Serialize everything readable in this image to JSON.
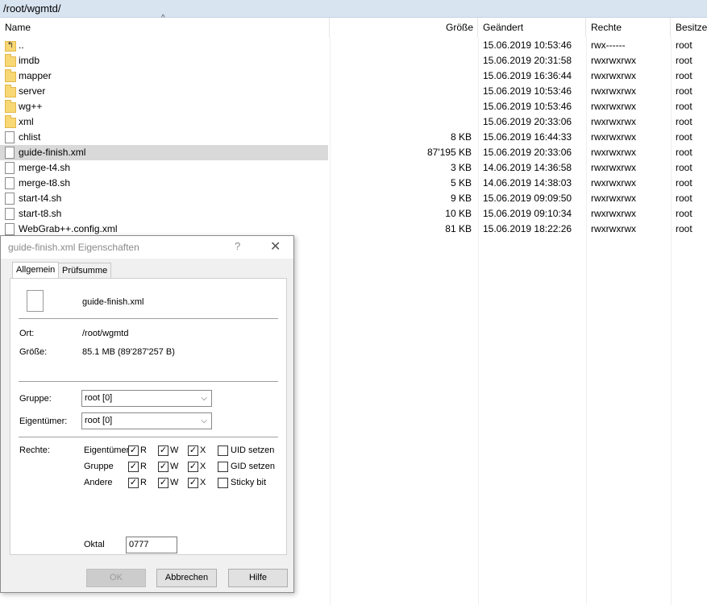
{
  "path": "/root/wgmtd/",
  "columns": {
    "name": "Name",
    "size": "Größe",
    "modified": "Geändert",
    "perms": "Rechte",
    "owner": "Besitzer"
  },
  "files": [
    {
      "name": "..",
      "size": "",
      "modified": "15.06.2019 10:53:46",
      "perms": "rwx------",
      "owner": "root",
      "type": "up"
    },
    {
      "name": "imdb",
      "size": "",
      "modified": "15.06.2019 20:31:58",
      "perms": "rwxrwxrwx",
      "owner": "root",
      "type": "folder"
    },
    {
      "name": "mapper",
      "size": "",
      "modified": "15.06.2019 16:36:44",
      "perms": "rwxrwxrwx",
      "owner": "root",
      "type": "folder"
    },
    {
      "name": "server",
      "size": "",
      "modified": "15.06.2019 10:53:46",
      "perms": "rwxrwxrwx",
      "owner": "root",
      "type": "folder"
    },
    {
      "name": "wg++",
      "size": "",
      "modified": "15.06.2019 10:53:46",
      "perms": "rwxrwxrwx",
      "owner": "root",
      "type": "folder"
    },
    {
      "name": "xml",
      "size": "",
      "modified": "15.06.2019 20:33:06",
      "perms": "rwxrwxrwx",
      "owner": "root",
      "type": "folder"
    },
    {
      "name": "chlist",
      "size": "8 KB",
      "modified": "15.06.2019 16:44:33",
      "perms": "rwxrwxrwx",
      "owner": "root",
      "type": "file"
    },
    {
      "name": "guide-finish.xml",
      "size": "87'195 KB",
      "modified": "15.06.2019 20:33:06",
      "perms": "rwxrwxrwx",
      "owner": "root",
      "type": "file",
      "selected": true
    },
    {
      "name": "merge-t4.sh",
      "size": "3 KB",
      "modified": "14.06.2019 14:36:58",
      "perms": "rwxrwxrwx",
      "owner": "root",
      "type": "file"
    },
    {
      "name": "merge-t8.sh",
      "size": "5 KB",
      "modified": "14.06.2019 14:38:03",
      "perms": "rwxrwxrwx",
      "owner": "root",
      "type": "file"
    },
    {
      "name": "start-t4.sh",
      "size": "9 KB",
      "modified": "15.06.2019 09:09:50",
      "perms": "rwxrwxrwx",
      "owner": "root",
      "type": "file"
    },
    {
      "name": "start-t8.sh",
      "size": "10 KB",
      "modified": "15.06.2019 09:10:34",
      "perms": "rwxrwxrwx",
      "owner": "root",
      "type": "file"
    },
    {
      "name": "WebGrab++.config.xml",
      "size": "81 KB",
      "modified": "15.06.2019 18:22:26",
      "perms": "rwxrwxrwx",
      "owner": "root",
      "type": "file"
    }
  ],
  "dialog": {
    "title": "guide-finish.xml Eigenschaften",
    "help_glyph": "?",
    "tabs": [
      "Allgemein",
      "Prüfsumme"
    ],
    "filename": "guide-finish.xml",
    "location_label": "Ort:",
    "location_value": "/root/wgmtd",
    "size_label": "Größe:",
    "size_value": "85.1 MB (89'287'257 B)",
    "group_label": "Gruppe:",
    "group_value": "root [0]",
    "owner_label": "Eigentümer:",
    "owner_value": "root [0]",
    "rights_label": "Rechte:",
    "rights_rows": [
      "Eigentümer",
      "Gruppe",
      "Andere"
    ],
    "perm_letters": [
      "R",
      "W",
      "X"
    ],
    "special": [
      "UID setzen",
      "GID setzen",
      "Sticky bit"
    ],
    "octal_label": "Oktal",
    "octal_value": "0777",
    "buttons": {
      "ok": "OK",
      "cancel": "Abbrechen",
      "help": "Hilfe"
    }
  }
}
